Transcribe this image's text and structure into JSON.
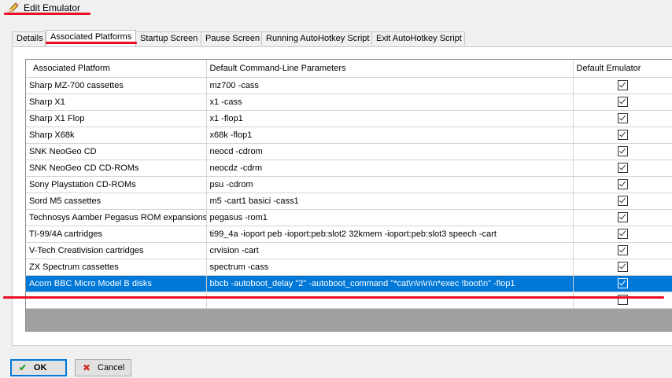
{
  "window": {
    "title": "Edit Emulator",
    "title_icon": "pencil-icon"
  },
  "tabs": [
    {
      "label": "Details"
    },
    {
      "label": "Associated Platforms"
    },
    {
      "label": "Startup Screen"
    },
    {
      "label": "Pause Screen"
    },
    {
      "label": "Running AutoHotkey Script"
    },
    {
      "label": "Exit AutoHotkey Script"
    }
  ],
  "active_tab": "Associated Platforms",
  "grid": {
    "columns": [
      "Associated Platform",
      "Default Command-Line Parameters",
      "Default Emulator"
    ],
    "rows": [
      {
        "platform": "Sharp MZ-700 cassettes",
        "params": "mz700 -cass",
        "default": true
      },
      {
        "platform": "Sharp X1",
        "params": "x1 -cass",
        "default": true
      },
      {
        "platform": "Sharp X1 Flop",
        "params": "x1 -flop1",
        "default": true
      },
      {
        "platform": "Sharp X68k",
        "params": "x68k -flop1",
        "default": true
      },
      {
        "platform": "SNK NeoGeo CD",
        "params": "neocd -cdrom",
        "default": true
      },
      {
        "platform": "SNK NeoGeo CD CD-ROMs",
        "params": "neocdz -cdrm",
        "default": true
      },
      {
        "platform": "Sony Playstation CD-ROMs",
        "params": "psu -cdrom",
        "default": true
      },
      {
        "platform": "Sord M5 cassettes",
        "params": "m5 -cart1 basici -cass1",
        "default": true
      },
      {
        "platform": "Technosys Aamber Pegasus ROM expansions",
        "params": "pegasus -rom1",
        "default": true
      },
      {
        "platform": "TI-99/4A cartridges",
        "params": "ti99_4a -ioport peb -ioport:peb:slot2 32kmem -ioport:peb:slot3 speech -cart",
        "default": true
      },
      {
        "platform": "V-Tech Creativision cartridges",
        "params": "crvision -cart",
        "default": true
      },
      {
        "platform": "ZX Spectrum cassettes",
        "params": "spectrum -cass",
        "default": true
      },
      {
        "platform": "Acorn BBC Micro Model B disks",
        "params": "bbcb -autoboot_delay \"2\" -autoboot_command \"*cat\\n\\n\\n\\n*exec !boot\\n\" -flop1",
        "default": true,
        "selected": true
      },
      {
        "platform": "",
        "params": "",
        "default": false
      }
    ]
  },
  "buttons": {
    "ok": {
      "label": "OK",
      "icon": "check-icon"
    },
    "cancel": {
      "label": "Cancel",
      "icon": "cross-icon"
    }
  },
  "colors": {
    "selection": "#0078d7",
    "annotation_red": "#e81123"
  }
}
